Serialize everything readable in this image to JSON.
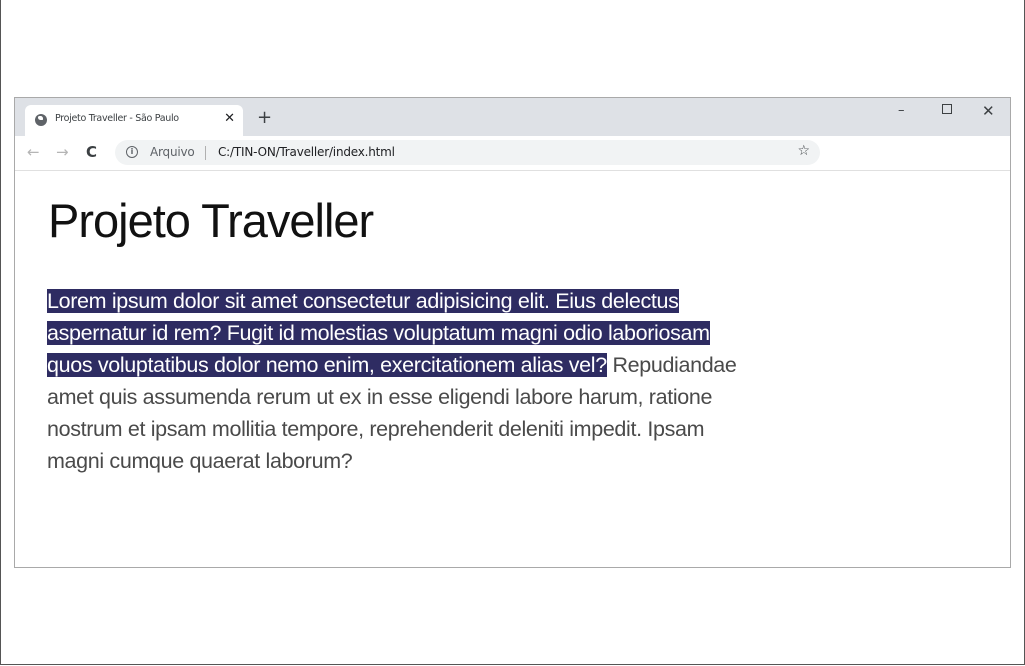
{
  "browser": {
    "tab": {
      "title": "Projeto Traveller - São Paulo",
      "close_glyph": "✕",
      "favicon": "globe-icon"
    },
    "new_tab_glyph": "+",
    "window_controls": {
      "minimize_glyph": "–",
      "close_glyph": "✕"
    },
    "nav": {
      "back_glyph": "←",
      "forward_glyph": "→",
      "reload_glyph": "C"
    },
    "omnibox": {
      "info_glyph": "i",
      "scheme": "Arquivo",
      "url": "C:/TIN-ON/Traveller/index.html",
      "star_glyph": "☆"
    }
  },
  "page": {
    "title": "Projeto Traveller",
    "paragraph_selected": "Lorem ipsum dolor sit amet consectetur adipisicing elit. Eius delectus aspernatur id rem? Fugit id molestias voluptatum magni odio laboriosam quos voluptatibus dolor nemo enim, exercitationem alias vel?",
    "paragraph_rest": " Repudiandae amet quis assumenda rerum ut ex in esse eligendi labore harum, ratione nostrum et ipsam mollitia tempore, reprehenderit deleniti impedit. Ipsam magni cumque quaerat laborum?",
    "selection_color": "#2e2c62"
  }
}
